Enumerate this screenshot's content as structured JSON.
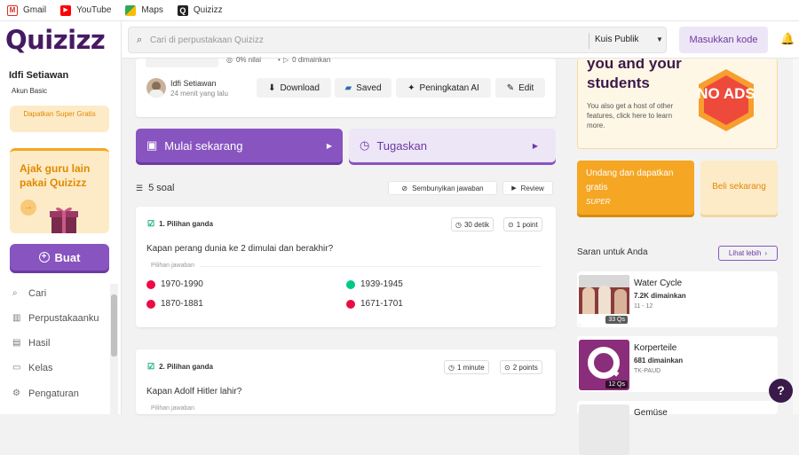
{
  "bookmarks": [
    {
      "label": "Gmail",
      "icon": "gmail-icon",
      "color": "#d93025"
    },
    {
      "label": "YouTube",
      "icon": "youtube-icon",
      "color": "#ff0000"
    },
    {
      "label": "Maps",
      "icon": "maps-icon",
      "color": "#34a853"
    },
    {
      "label": "Quizizz",
      "icon": "quizizz-icon",
      "color": "#222222"
    }
  ],
  "sidebar": {
    "logo": "Quizizz",
    "user_name": "Idfi Setiawan",
    "plan": "Akun Basic",
    "super_button": "Dapatkan Super Gratis",
    "invite_title": "Ajak guru lain pakai Quizizz",
    "create_label": "Buat",
    "nav": [
      {
        "label": "Cari",
        "icon": "search-icon"
      },
      {
        "label": "Perpustakaanku",
        "icon": "library-icon"
      },
      {
        "label": "Hasil",
        "icon": "results-icon"
      },
      {
        "label": "Kelas",
        "icon": "class-icon"
      },
      {
        "label": "Pengaturan",
        "icon": "settings-icon"
      }
    ]
  },
  "topbar": {
    "search_placeholder": "Cari di perpustakaan Quizizz",
    "scope": "Kuis Publik",
    "join_label": "Masukkan kode"
  },
  "quiz": {
    "accuracy": "0% nilai",
    "plays": "0 dimainkan",
    "author": "Idfi Setiawan",
    "updated": "24 menit yang lalu",
    "actions": [
      "Download",
      "Saved",
      "Peningkatan AI",
      "Edit"
    ],
    "start_label": "Mulai sekarang",
    "assign_label": "Tugaskan",
    "count_label": "5 soal",
    "hide_answers": "Sembunyikan jawaban",
    "review": "Review"
  },
  "questions": [
    {
      "title": "1. Pilihan ganda",
      "time": "30 detik",
      "points": "1 point",
      "text": "Kapan perang dunia ke 2 dimulai dan berakhir?",
      "answers_label": "Pilihan jawaban",
      "answers": [
        {
          "text": "1970-1990",
          "correct": false
        },
        {
          "text": "1939-1945",
          "correct": true
        },
        {
          "text": "1870-1881",
          "correct": false
        },
        {
          "text": "1671-1701",
          "correct": false
        }
      ]
    },
    {
      "title": "2. Pilihan ganda",
      "time": "1 minute",
      "points": "2 points",
      "text": "Kapan Adolf Hitler lahir?",
      "answers_label": "Pilihan jawaban"
    }
  ],
  "promo": {
    "headline": "you and your students",
    "body": "You also get a host of other features, click here to learn more.",
    "badge": "NO ADS"
  },
  "invite_card": {
    "title": "Undang dan dapatkan gratis",
    "tag": "SUPER"
  },
  "buy_card": {
    "title": "Beli sekarang"
  },
  "suggestions": {
    "title": "Saran untuk Anda",
    "more": "Lihat lebih",
    "items": [
      {
        "title": "Water Cycle",
        "plays": "7.2K dimainkan",
        "grade": "11 - 12",
        "qs": "33 Qs"
      },
      {
        "title": "Korperteile",
        "plays": "681 dimainkan",
        "grade": "TK-PAUD",
        "qs": "12 Qs"
      },
      {
        "title": "Gemüse",
        "plays": "",
        "grade": "",
        "qs": ""
      }
    ]
  },
  "colors": {
    "brand": "#8854c0",
    "correct": "#00c985",
    "incorrect": "#ec0b43",
    "accent": "#f5a623"
  }
}
